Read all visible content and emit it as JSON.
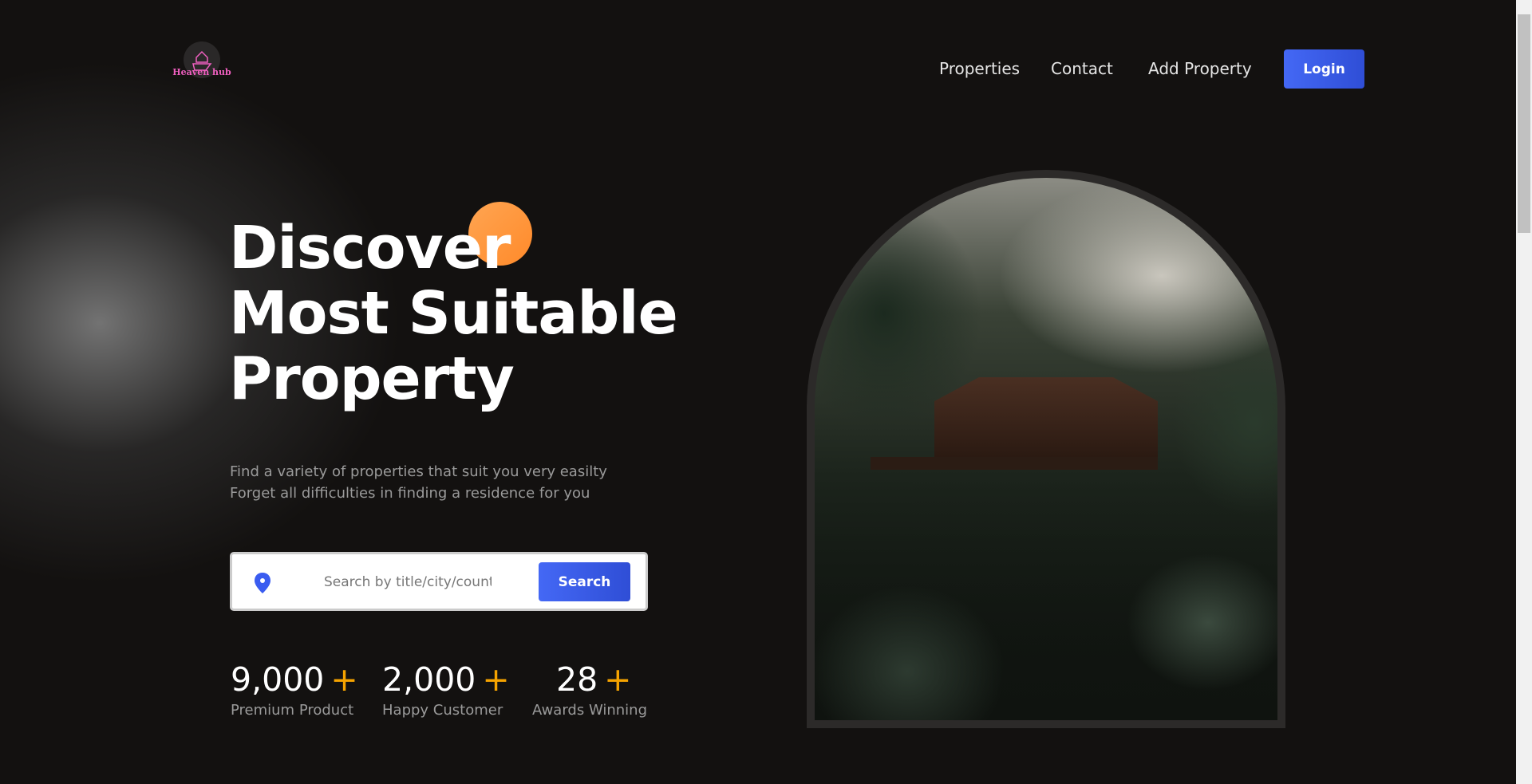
{
  "brand": {
    "name": "Heaven hub"
  },
  "nav": {
    "items": [
      "Properties",
      "Contact",
      "Add Property"
    ],
    "login": "Login"
  },
  "hero": {
    "title_lines": [
      "Discover",
      "Most Suitable",
      "Property"
    ],
    "subtitle_lines": [
      "Find a variety of properties that suit you very easilty",
      "Forget all difficulties in finding a residence for you"
    ]
  },
  "search": {
    "placeholder": "Search by title/city/country",
    "button": "Search",
    "icon": "location-pin-icon"
  },
  "stats": [
    {
      "value": "9,000",
      "plus": "+",
      "label": "Premium Product"
    },
    {
      "value": "2,000",
      "plus": "+",
      "label": "Happy Customer"
    },
    {
      "value": "28",
      "plus": "+",
      "label": "Awards Winning"
    }
  ],
  "colors": {
    "accent": "#3a5cf0",
    "orange": "#f5a300",
    "background": "#131110"
  }
}
